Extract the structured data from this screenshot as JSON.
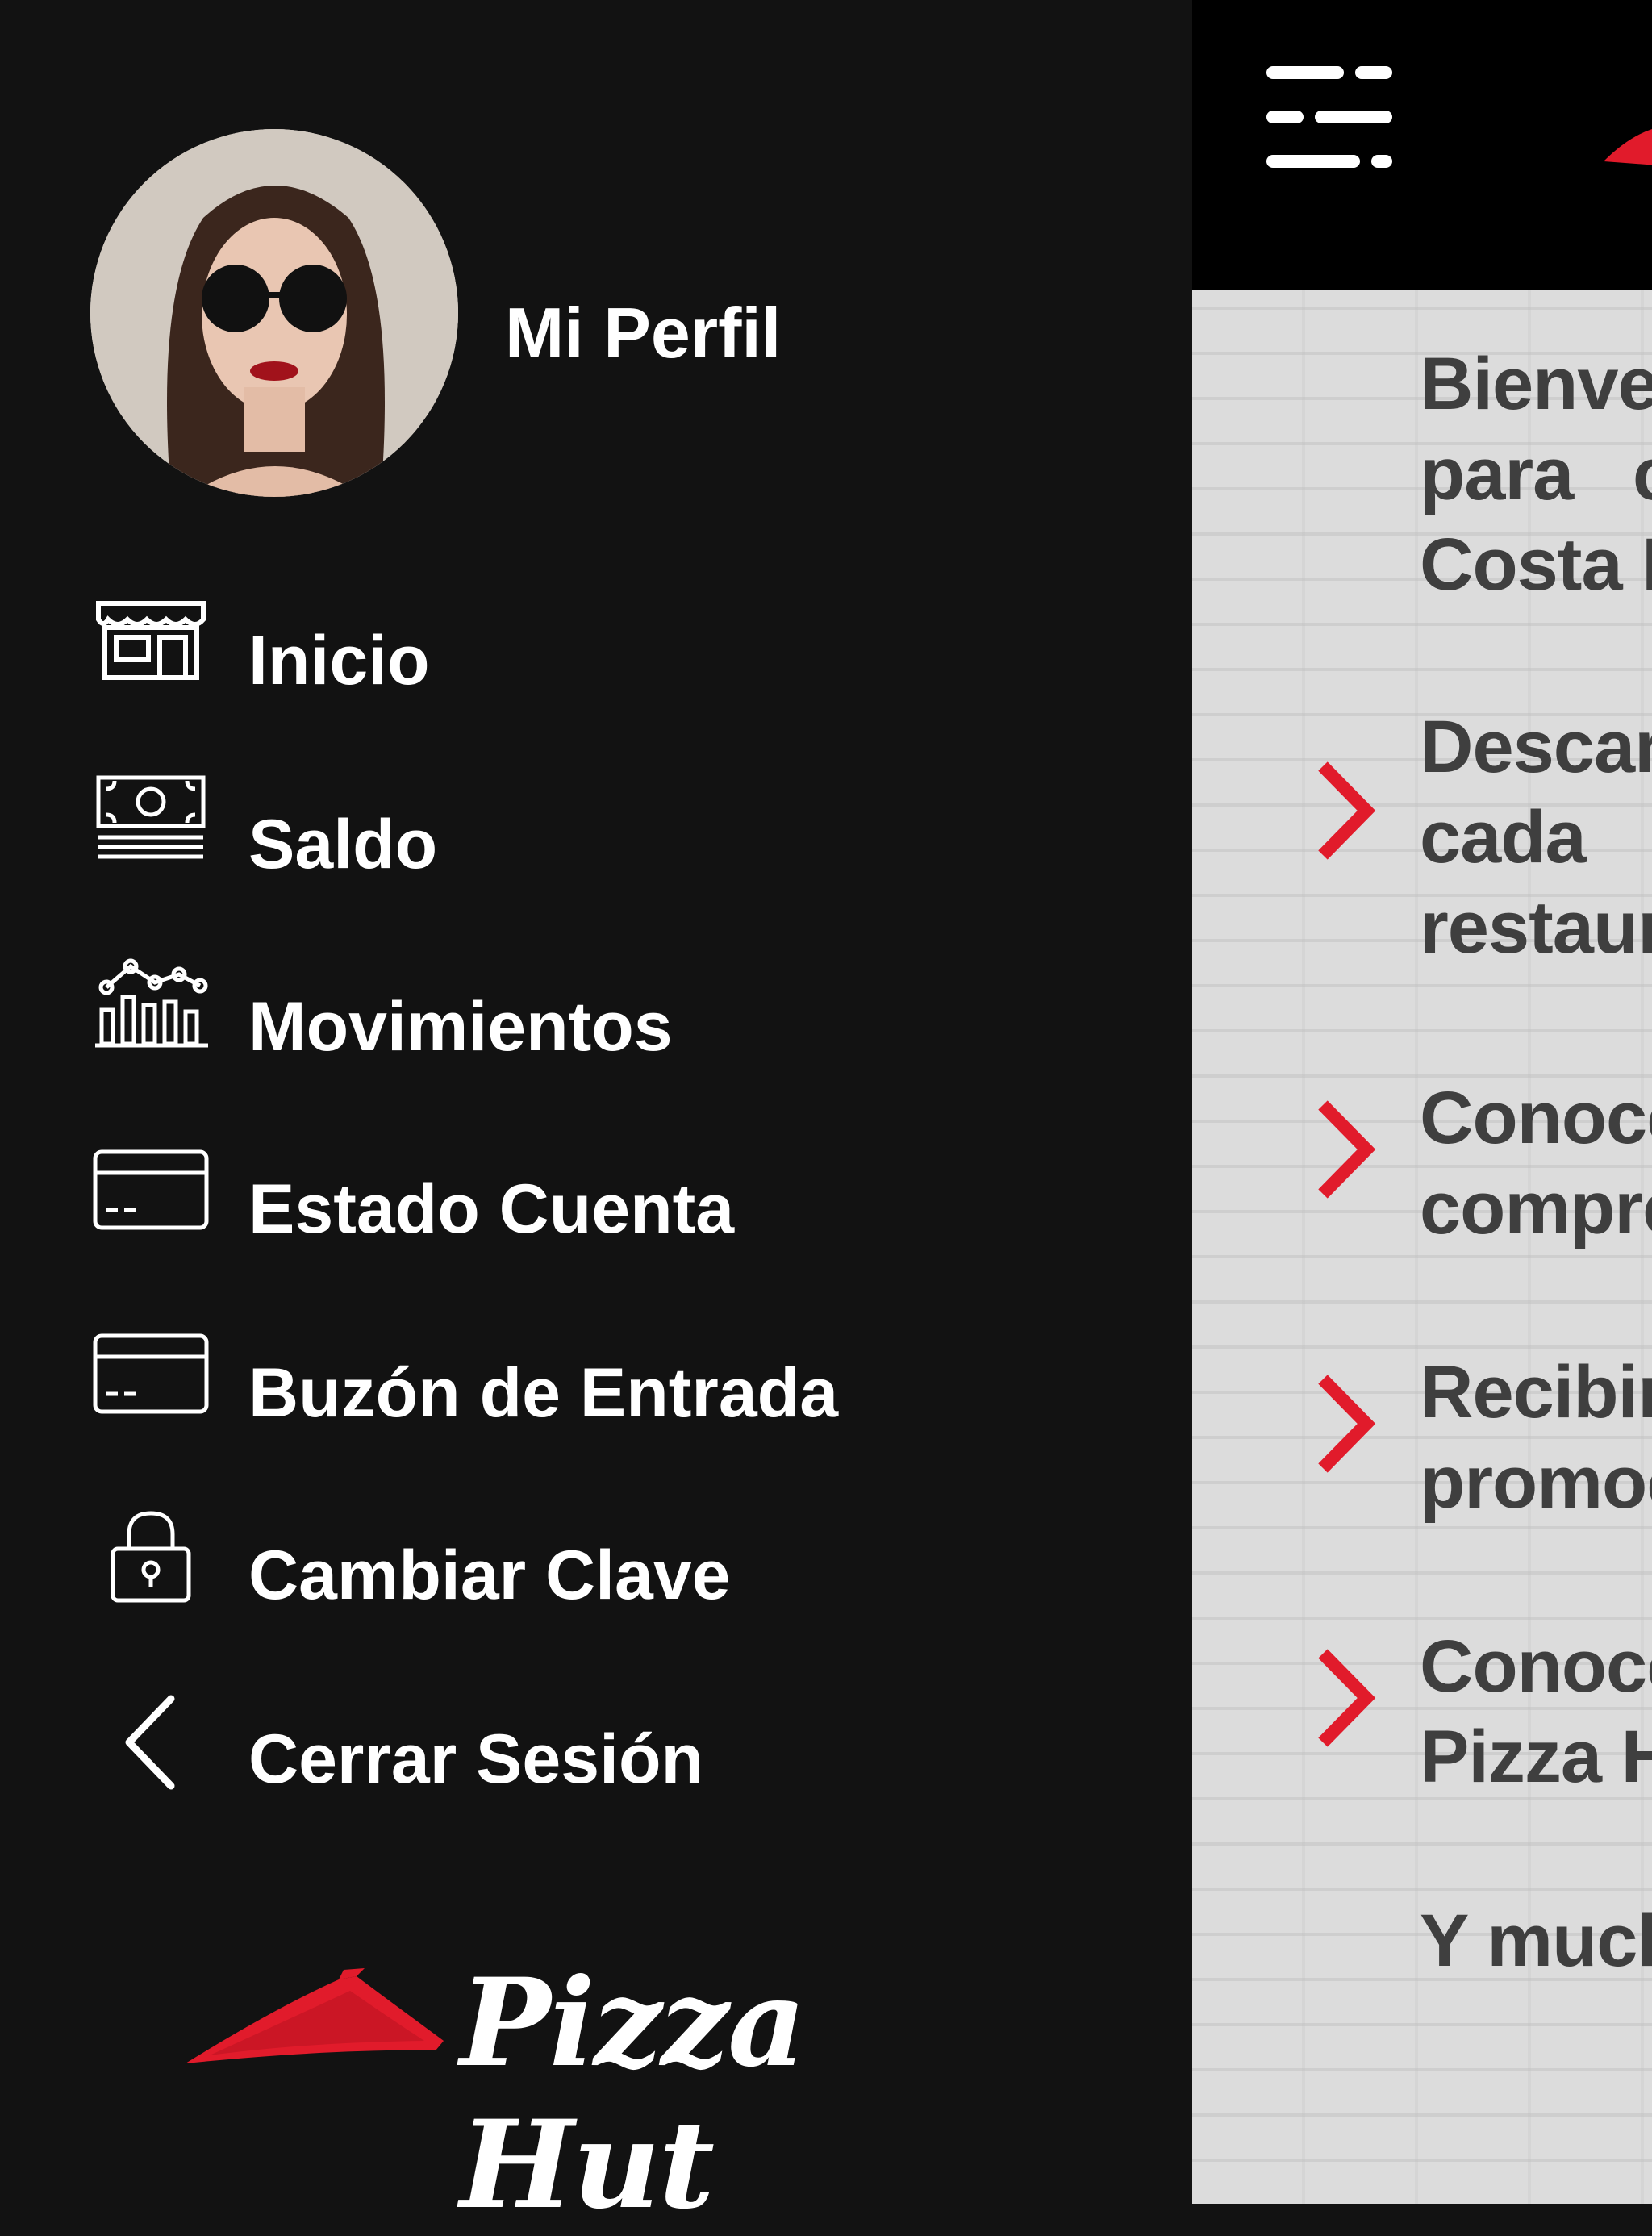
{
  "drawer": {
    "profile_label": "Mi Perfil",
    "items": [
      {
        "label": "Inicio",
        "icon": "store-icon"
      },
      {
        "label": "Saldo",
        "icon": "money-icon"
      },
      {
        "label": "Movimientos",
        "icon": "chart-icon"
      },
      {
        "label": "Estado Cuenta",
        "icon": "card-icon"
      },
      {
        "label": "Buzón de Entrada",
        "icon": "card-icon"
      },
      {
        "label": "Cambiar Clave",
        "icon": "lock-icon"
      },
      {
        "label": "Cerrar Sesión",
        "icon": "chevron-left-icon"
      }
    ],
    "logo_text": "Pizza Hut"
  },
  "content": {
    "paragraphs": [
      "Bienver\npara   c\nCosta I",
      "Descar\ncada\nrestaur",
      "Conoce\ncompre",
      "Recibir\npromoc",
      "Conoce\nPizza H",
      "Y much"
    ]
  },
  "colors": {
    "drawer_bg": "#121212",
    "accent_red": "#e11b2b",
    "panel_text": "#3f3f3f"
  }
}
